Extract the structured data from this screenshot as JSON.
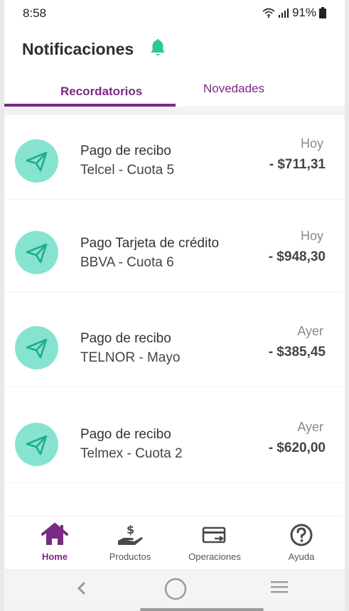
{
  "status_bar": {
    "time": "8:58",
    "battery": "91%"
  },
  "header": {
    "title": "Notificaciones",
    "bell_icon": "bell-icon",
    "accent_color": "#2cc79b"
  },
  "tabs": [
    {
      "label": "Recordatorios",
      "active": true
    },
    {
      "label": "Novedades",
      "active": false
    }
  ],
  "brand_color": "#7a2a82",
  "notifications": [
    {
      "title": "Pago de recibo",
      "subtitle": "Telcel - Cuota 5",
      "day": "Hoy",
      "amount": "- $711,31",
      "icon": "send-icon"
    },
    {
      "title": "Pago Tarjeta de crédito",
      "subtitle": "BBVA - Cuota 6",
      "day": "Hoy",
      "amount": "- $948,30",
      "icon": "send-icon"
    },
    {
      "title": "Pago de recibo",
      "subtitle": "TELNOR - Mayo",
      "day": "Ayer",
      "amount": "- $385,45",
      "icon": "send-icon"
    },
    {
      "title": "Pago de recibo",
      "subtitle": "Telmex - Cuota 2",
      "day": "Ayer",
      "amount": "- $620,00",
      "icon": "send-icon"
    }
  ],
  "bottom_nav": [
    {
      "label": "Home",
      "icon": "home-icon",
      "active": true
    },
    {
      "label": "Productos",
      "icon": "hand-money-icon",
      "active": false
    },
    {
      "label": "Operaciones",
      "icon": "card-transfer-icon",
      "active": false
    },
    {
      "label": "Ayuda",
      "icon": "help-icon",
      "active": false
    }
  ]
}
